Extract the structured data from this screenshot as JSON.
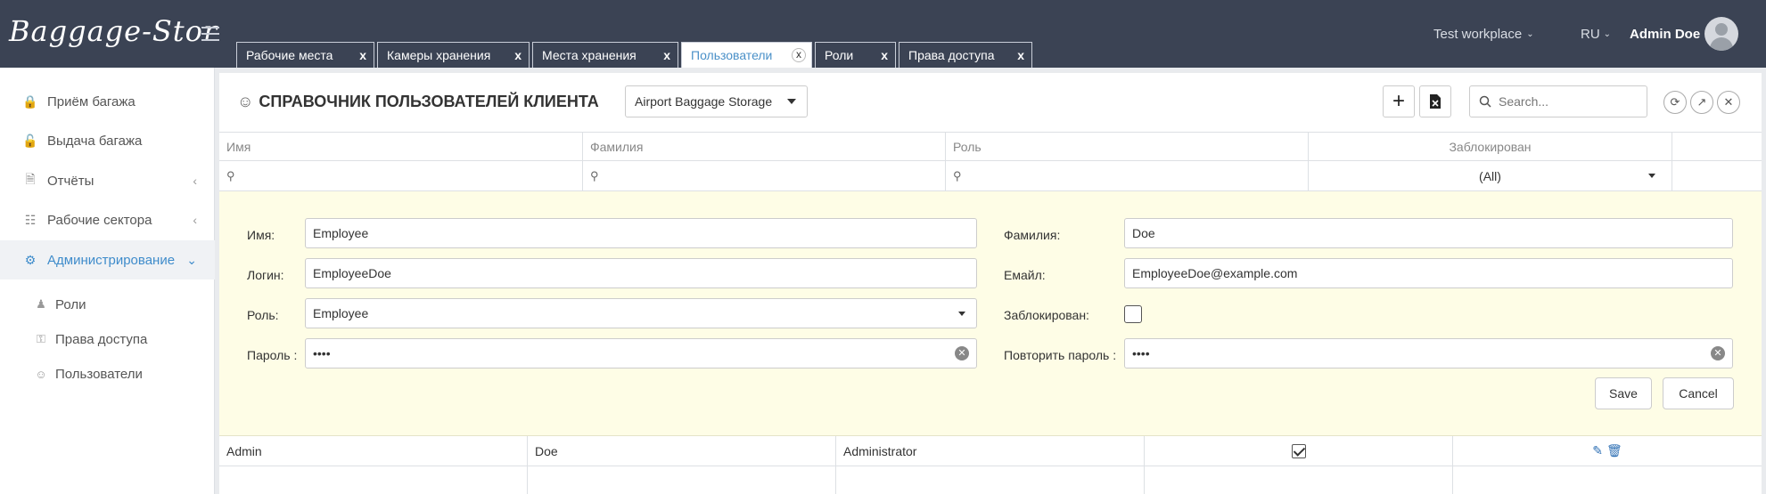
{
  "app": {
    "logo": "Baggage-Stor"
  },
  "tabs": [
    {
      "label": "Рабочие места",
      "close": "x"
    },
    {
      "label": "Камеры хранения",
      "close": "x"
    },
    {
      "label": "Места хранения",
      "close": "x"
    },
    {
      "label": "Пользователи",
      "close": "x",
      "active": true
    },
    {
      "label": "Роли",
      "close": "x"
    },
    {
      "label": "Права доступа",
      "close": "x"
    }
  ],
  "topbar": {
    "workplace": "Test workplace",
    "language": "RU",
    "user": "Admin Doe"
  },
  "sidebar": {
    "items": [
      {
        "label": "Приём багажа",
        "icon": "lock-icon"
      },
      {
        "label": "Выдача багажа",
        "icon": "unlock-icon"
      },
      {
        "label": "Отчёты",
        "icon": "documents-icon"
      },
      {
        "label": "Рабочие сектора",
        "icon": "sitemap-icon"
      },
      {
        "label": "Администрирование",
        "icon": "gear-icon"
      }
    ],
    "subitems": [
      {
        "label": "Роли",
        "icon": "user-role-icon"
      },
      {
        "label": "Права доступа",
        "icon": "key-icon"
      },
      {
        "label": "Пользователи",
        "icon": "user-icon"
      }
    ]
  },
  "main": {
    "title": "СПРАВОЧНИК ПОЛЬЗОВАТЕЛЕЙ КЛИЕНТА",
    "organization": "Airport Baggage Storage",
    "search_placeholder": "Search..."
  },
  "grid": {
    "columns": [
      "Имя",
      "Фамилия",
      "Роль",
      "Заблокирован"
    ],
    "filter_blocked": "(All)"
  },
  "form": {
    "first_name_label": "Имя:",
    "first_name_value": "Employee",
    "last_name_label": "Фамилия:",
    "last_name_value": "Doe",
    "login_label": "Логин:",
    "login_value": "EmployeeDoe",
    "email_label": "Емайл:",
    "email_value": "EmployeeDoe@example.com",
    "role_label": "Роль:",
    "role_value": "Employee",
    "blocked_label": "Заблокирован:",
    "blocked": false,
    "password_label": "Пароль :",
    "password_value": "••••",
    "repeat_password_label": "Повторить пароль :",
    "repeat_password_value": "••••",
    "save_label": "Save",
    "cancel_label": "Cancel"
  },
  "rows": [
    {
      "first_name": "Admin",
      "last_name": "Doe",
      "role": "Administrator",
      "blocked": true
    }
  ],
  "colors": {
    "topbar": "#3b4354",
    "accent": "#3f8ccb",
    "form_bg": "#fefde6"
  }
}
